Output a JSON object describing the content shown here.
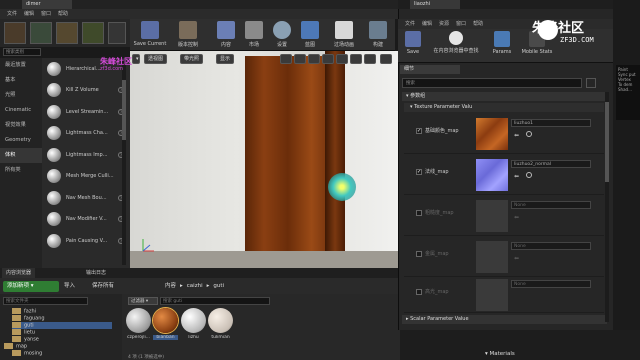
{
  "main": {
    "tab_title": "dimer",
    "menu": [
      "文件",
      "编辑",
      "窗口",
      "帮助"
    ],
    "toolbar": [
      "Save Current",
      "版本控制",
      "内容",
      "市场",
      "设置",
      "蓝图",
      "过场动画",
      "构建"
    ]
  },
  "left_panel": {
    "search_placeholder": "搜索类别",
    "categories": [
      "最近放置",
      "基本",
      "光照",
      "Cinematic",
      "视觉效果",
      "Geometry",
      "体积",
      "所有类"
    ],
    "selected_category_index": 6,
    "classes": [
      "Hierarchical...",
      "Kill Z Volume",
      "Level Streamin...",
      "Lightmass Cha...",
      "Lightmass Imp...",
      "Mesh Merge Culli...",
      "Nav Mesh Bou...",
      "Nav Modifier V...",
      "Pain Causing V..."
    ]
  },
  "viewport": {
    "buttons": [
      "透视图",
      "带光照",
      "显示"
    ]
  },
  "content_browser": {
    "tabs": [
      "内容浏览器",
      "输出日志"
    ],
    "add_button": "添加新项",
    "import_button": "导入",
    "save_all_button": "保存所有",
    "path": [
      "内容",
      "caizhi",
      "guti"
    ],
    "tree_search_placeholder": "搜索文件夹",
    "tree": [
      "fazhi",
      "faguang",
      "guti",
      "lietu",
      "yanse",
      "map",
      "mosing"
    ],
    "selected_tree_index": 2,
    "filter_label": "过滤器",
    "asset_search_placeholder": "搜索 guti",
    "assets": [
      "czperojli...",
      "bianban",
      "lizhu",
      "tulimian"
    ],
    "status": "4 项 (1 项被选中)"
  },
  "material_instance": {
    "tab_title": "liaozhi",
    "menu": [
      "文件",
      "编辑",
      "资源",
      "窗口",
      "帮助"
    ],
    "toolbar": [
      "Save",
      "在内容浏览器中查找",
      "Params",
      "Mobile Stats"
    ],
    "details_tab": "细节",
    "search_placeholder": "搜索",
    "params_group": "参数组",
    "texture_group": "Texture Parameter Valu",
    "params": [
      {
        "label": "基础颜色_map",
        "checked": true,
        "value": "liuzhuo1"
      },
      {
        "label": "法线_map",
        "checked": true,
        "value": "liuzhuo2_normal"
      },
      {
        "label": "粗糙度_map",
        "checked": false,
        "value": "None"
      },
      {
        "label": "金属_map",
        "checked": false,
        "value": "None"
      },
      {
        "label": "高光_map",
        "checked": false,
        "value": "None"
      }
    ],
    "scalar_group": "Scalar Parameter Value"
  },
  "watermark": {
    "brand": "朱峰社区",
    "domain": "ZF3D.COM",
    "mid_brand": "朱峰社区",
    "mid_domain": "zf3d.com"
  },
  "right_log": [
    "Paint",
    "Sync put",
    "Vertex",
    "To dem",
    "Shad..."
  ],
  "bottom": {
    "materials_label": "Materials"
  }
}
